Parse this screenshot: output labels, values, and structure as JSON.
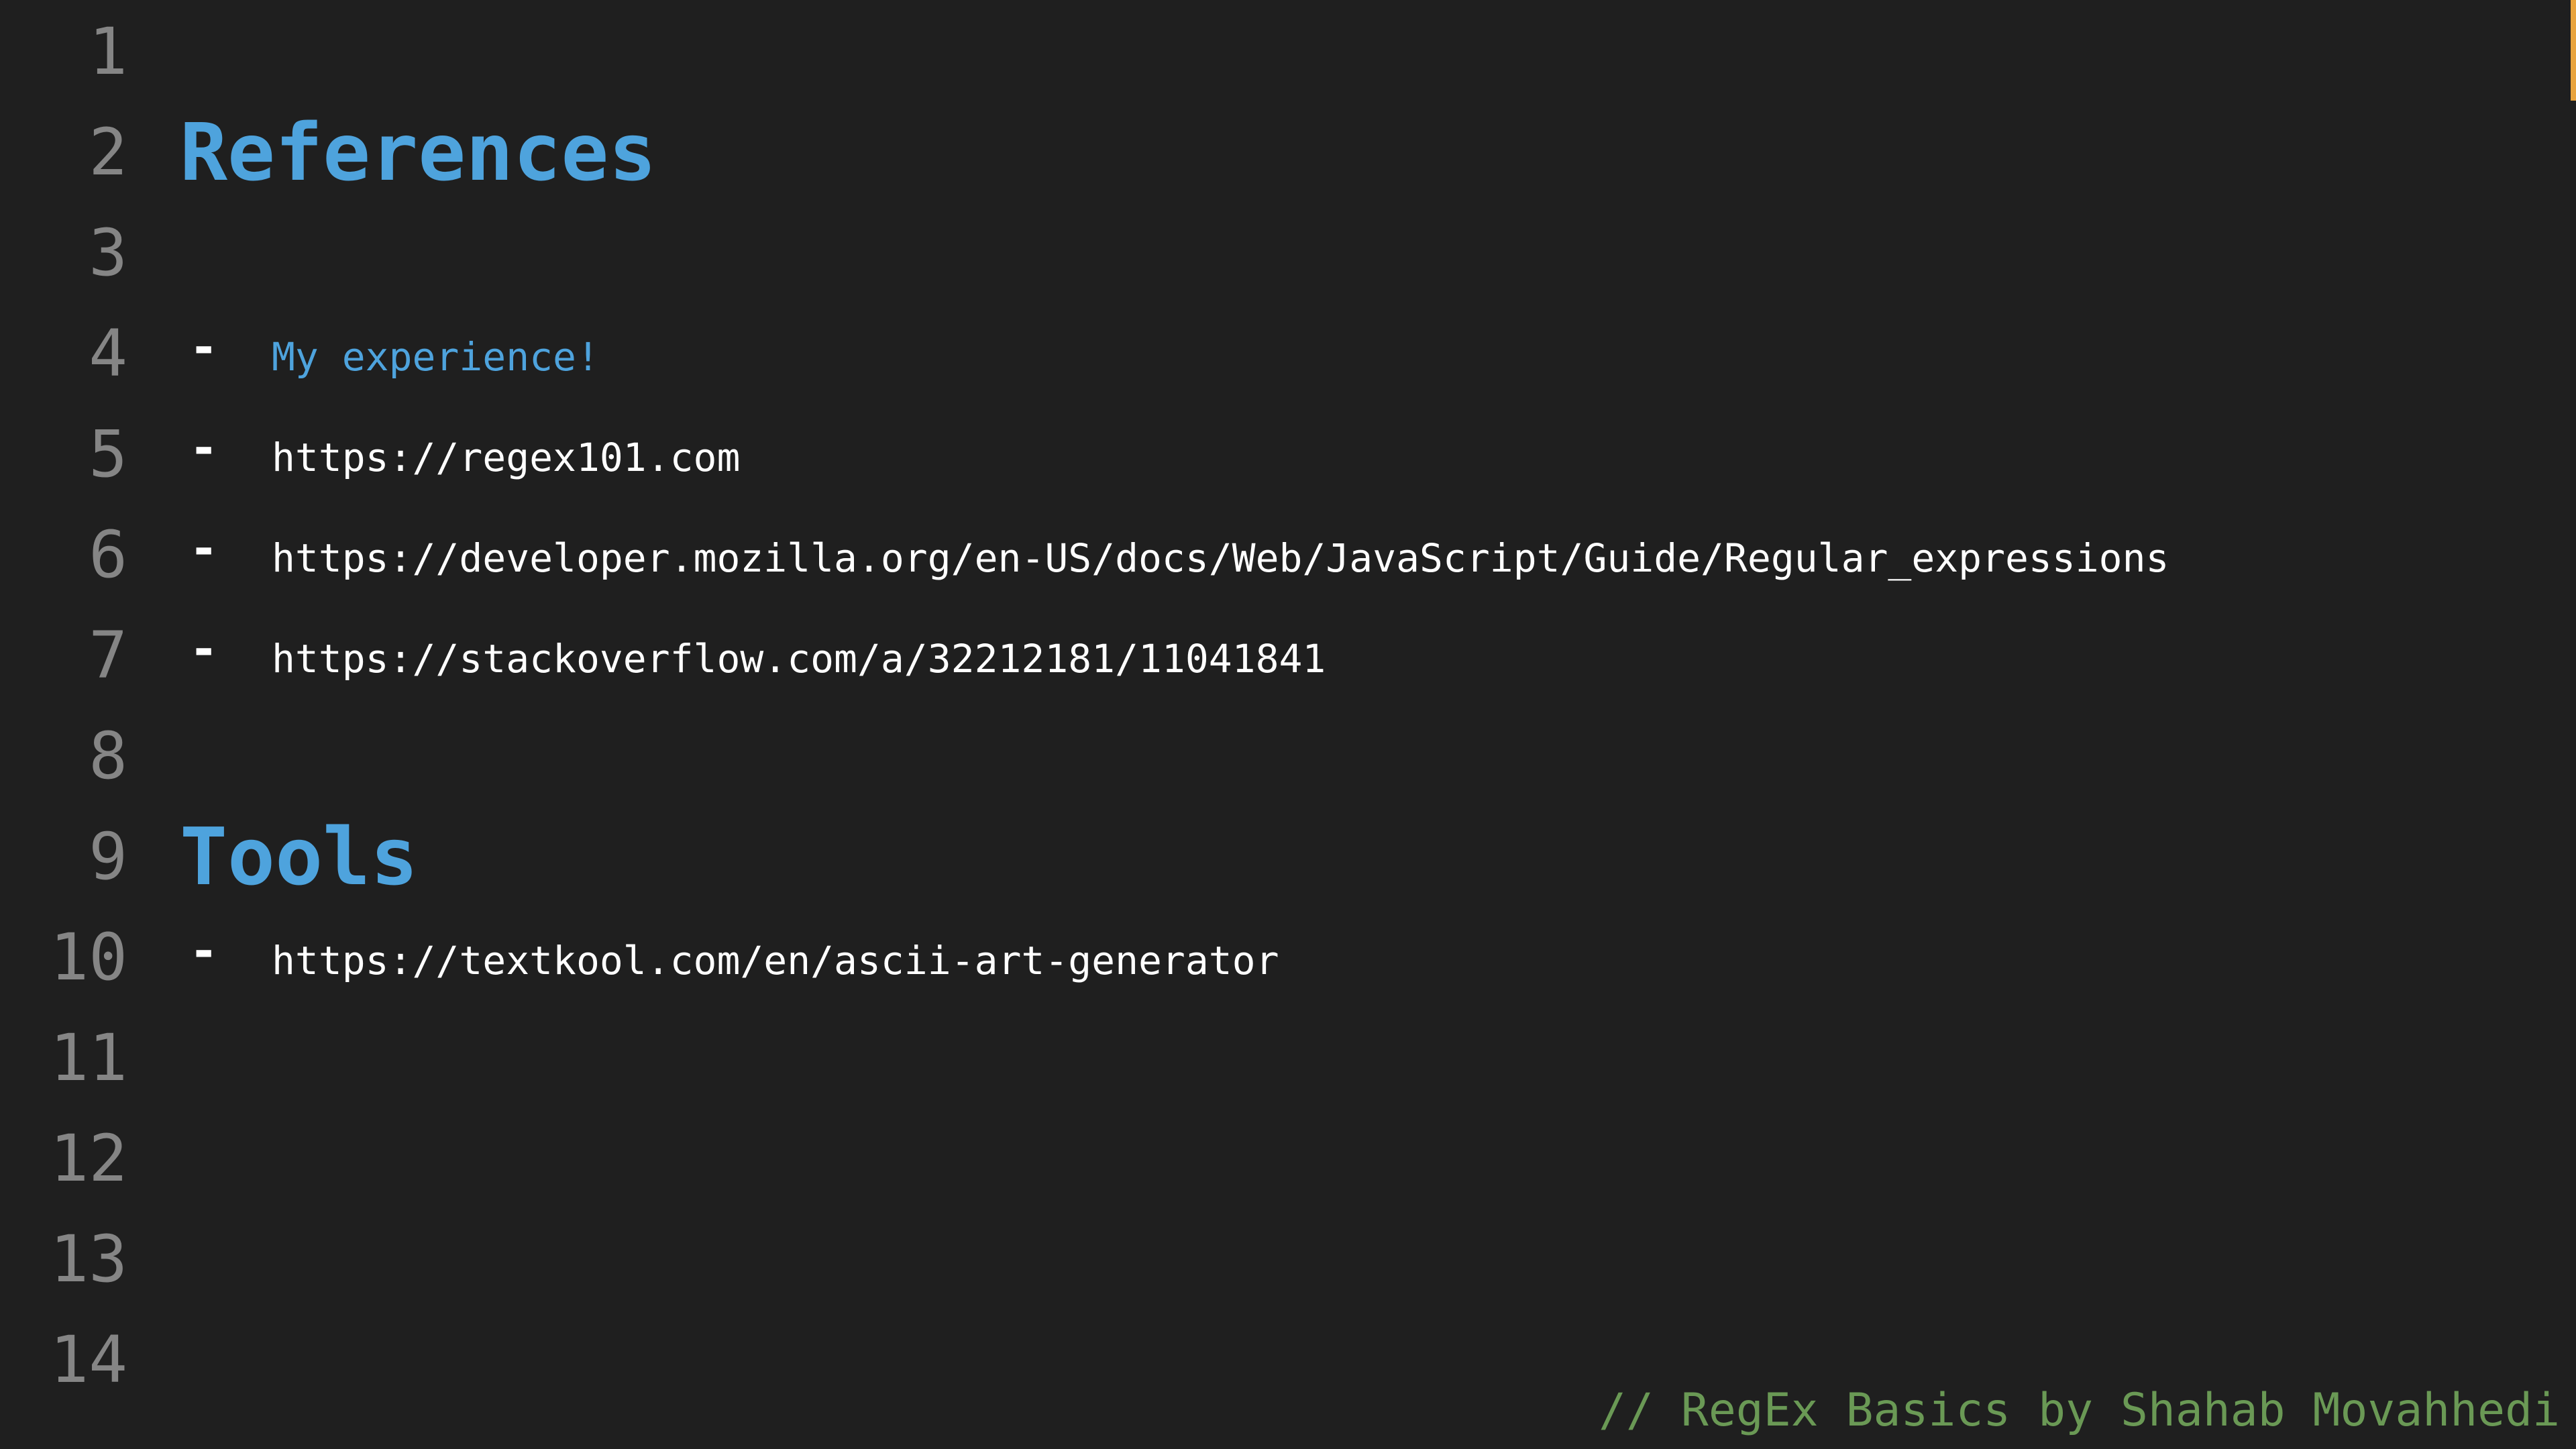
{
  "editor": {
    "line_numbers": [
      "1",
      "2",
      "3",
      "4",
      "5",
      "6",
      "7",
      "8",
      "9",
      "10",
      "11",
      "12",
      "13",
      "14"
    ],
    "headings": {
      "references": "References",
      "tools": "Tools"
    },
    "bullet_glyph": "-",
    "references_items": [
      "My experience!",
      "https://regex101.com",
      "https://developer.mozilla.org/en-US/docs/Web/JavaScript/Guide/Regular_expressions",
      "https://stackoverflow.com/a/32212181/11041841"
    ],
    "tools_items": [
      "https://textkool.com/en/ascii-art-generator"
    ],
    "signature": "// RegEx Basics by Shahab Movahhedi"
  },
  "colors": {
    "background": "#1f1f1f",
    "heading": "#4ea3dd",
    "line_number": "#858585",
    "comment": "#6a9955",
    "text": "#ffffff",
    "scroll_marker": "#e8a33d"
  }
}
